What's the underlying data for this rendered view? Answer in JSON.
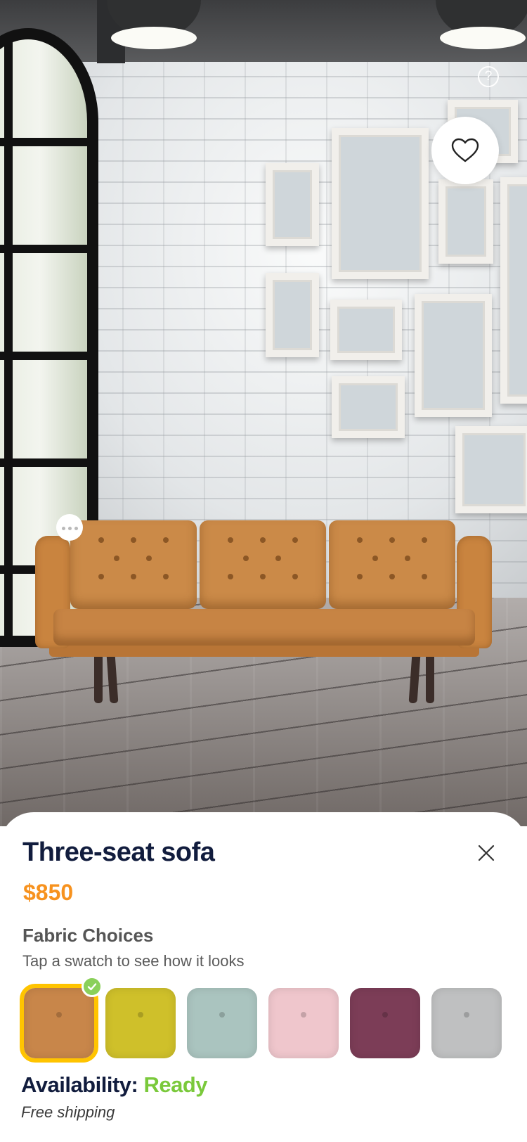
{
  "product": {
    "title": "Three-seat sofa",
    "price": "$850"
  },
  "fabric": {
    "heading": "Fabric Choices",
    "hint": "Tap a swatch to see how it looks",
    "selected_index": 0,
    "swatches": [
      {
        "name": "caramel",
        "color": "#c8864a"
      },
      {
        "name": "mustard",
        "color": "#cfc02a"
      },
      {
        "name": "sage",
        "color": "#aac4bf"
      },
      {
        "name": "blush",
        "color": "#efc6cc"
      },
      {
        "name": "plum",
        "color": "#7c3d57"
      },
      {
        "name": "heather-grey",
        "color": "#bfc0c1"
      }
    ]
  },
  "availability": {
    "label": "Availability:",
    "status": "Ready",
    "shipping": "Free shipping"
  },
  "overlay": {
    "help_icon": "?",
    "favorite_icon": "heart-icon",
    "more_icon": "more-icon",
    "close_icon": "close-icon"
  },
  "colors": {
    "title": "#111c3d",
    "price": "#f7921e",
    "status_ready": "#7ac93b",
    "selected_outline": "#ffc400",
    "check": "#8ad05a"
  }
}
